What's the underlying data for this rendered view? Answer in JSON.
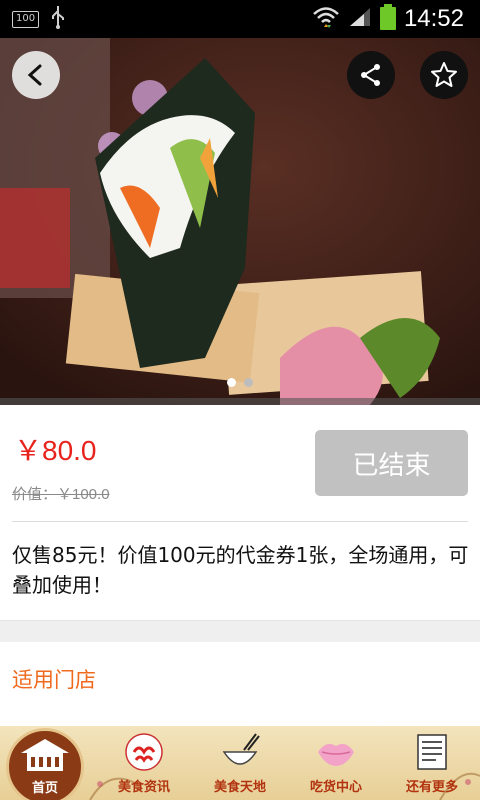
{
  "status_bar": {
    "battery_level_badge": "100",
    "time": "14:52"
  },
  "hero": {
    "image_description": "sushi hand roll photo",
    "carousel": {
      "count": 2,
      "active_index": 1
    }
  },
  "deal": {
    "price": "￥80.0",
    "original_price": "价值：￥100.0",
    "status_button": "已结束",
    "description": "仅售85元！价值100元的代金券1张，全场通用，可叠加使用！"
  },
  "stores": {
    "label": "适用门店"
  },
  "bottom_nav": {
    "items": [
      {
        "label": "首页",
        "icon": "home-icon",
        "active": true
      },
      {
        "label": "美食资讯",
        "icon": "food-news-icon"
      },
      {
        "label": "美食天地",
        "icon": "bowl-icon"
      },
      {
        "label": "吃货中心",
        "icon": "lips-icon"
      },
      {
        "label": "还有更多",
        "icon": "more-icon"
      }
    ]
  },
  "colors": {
    "price": "#e8231d",
    "stores_label": "#ef6a1d",
    "button_disabled": "#c1c1c1",
    "nav_text": "#b23310"
  }
}
